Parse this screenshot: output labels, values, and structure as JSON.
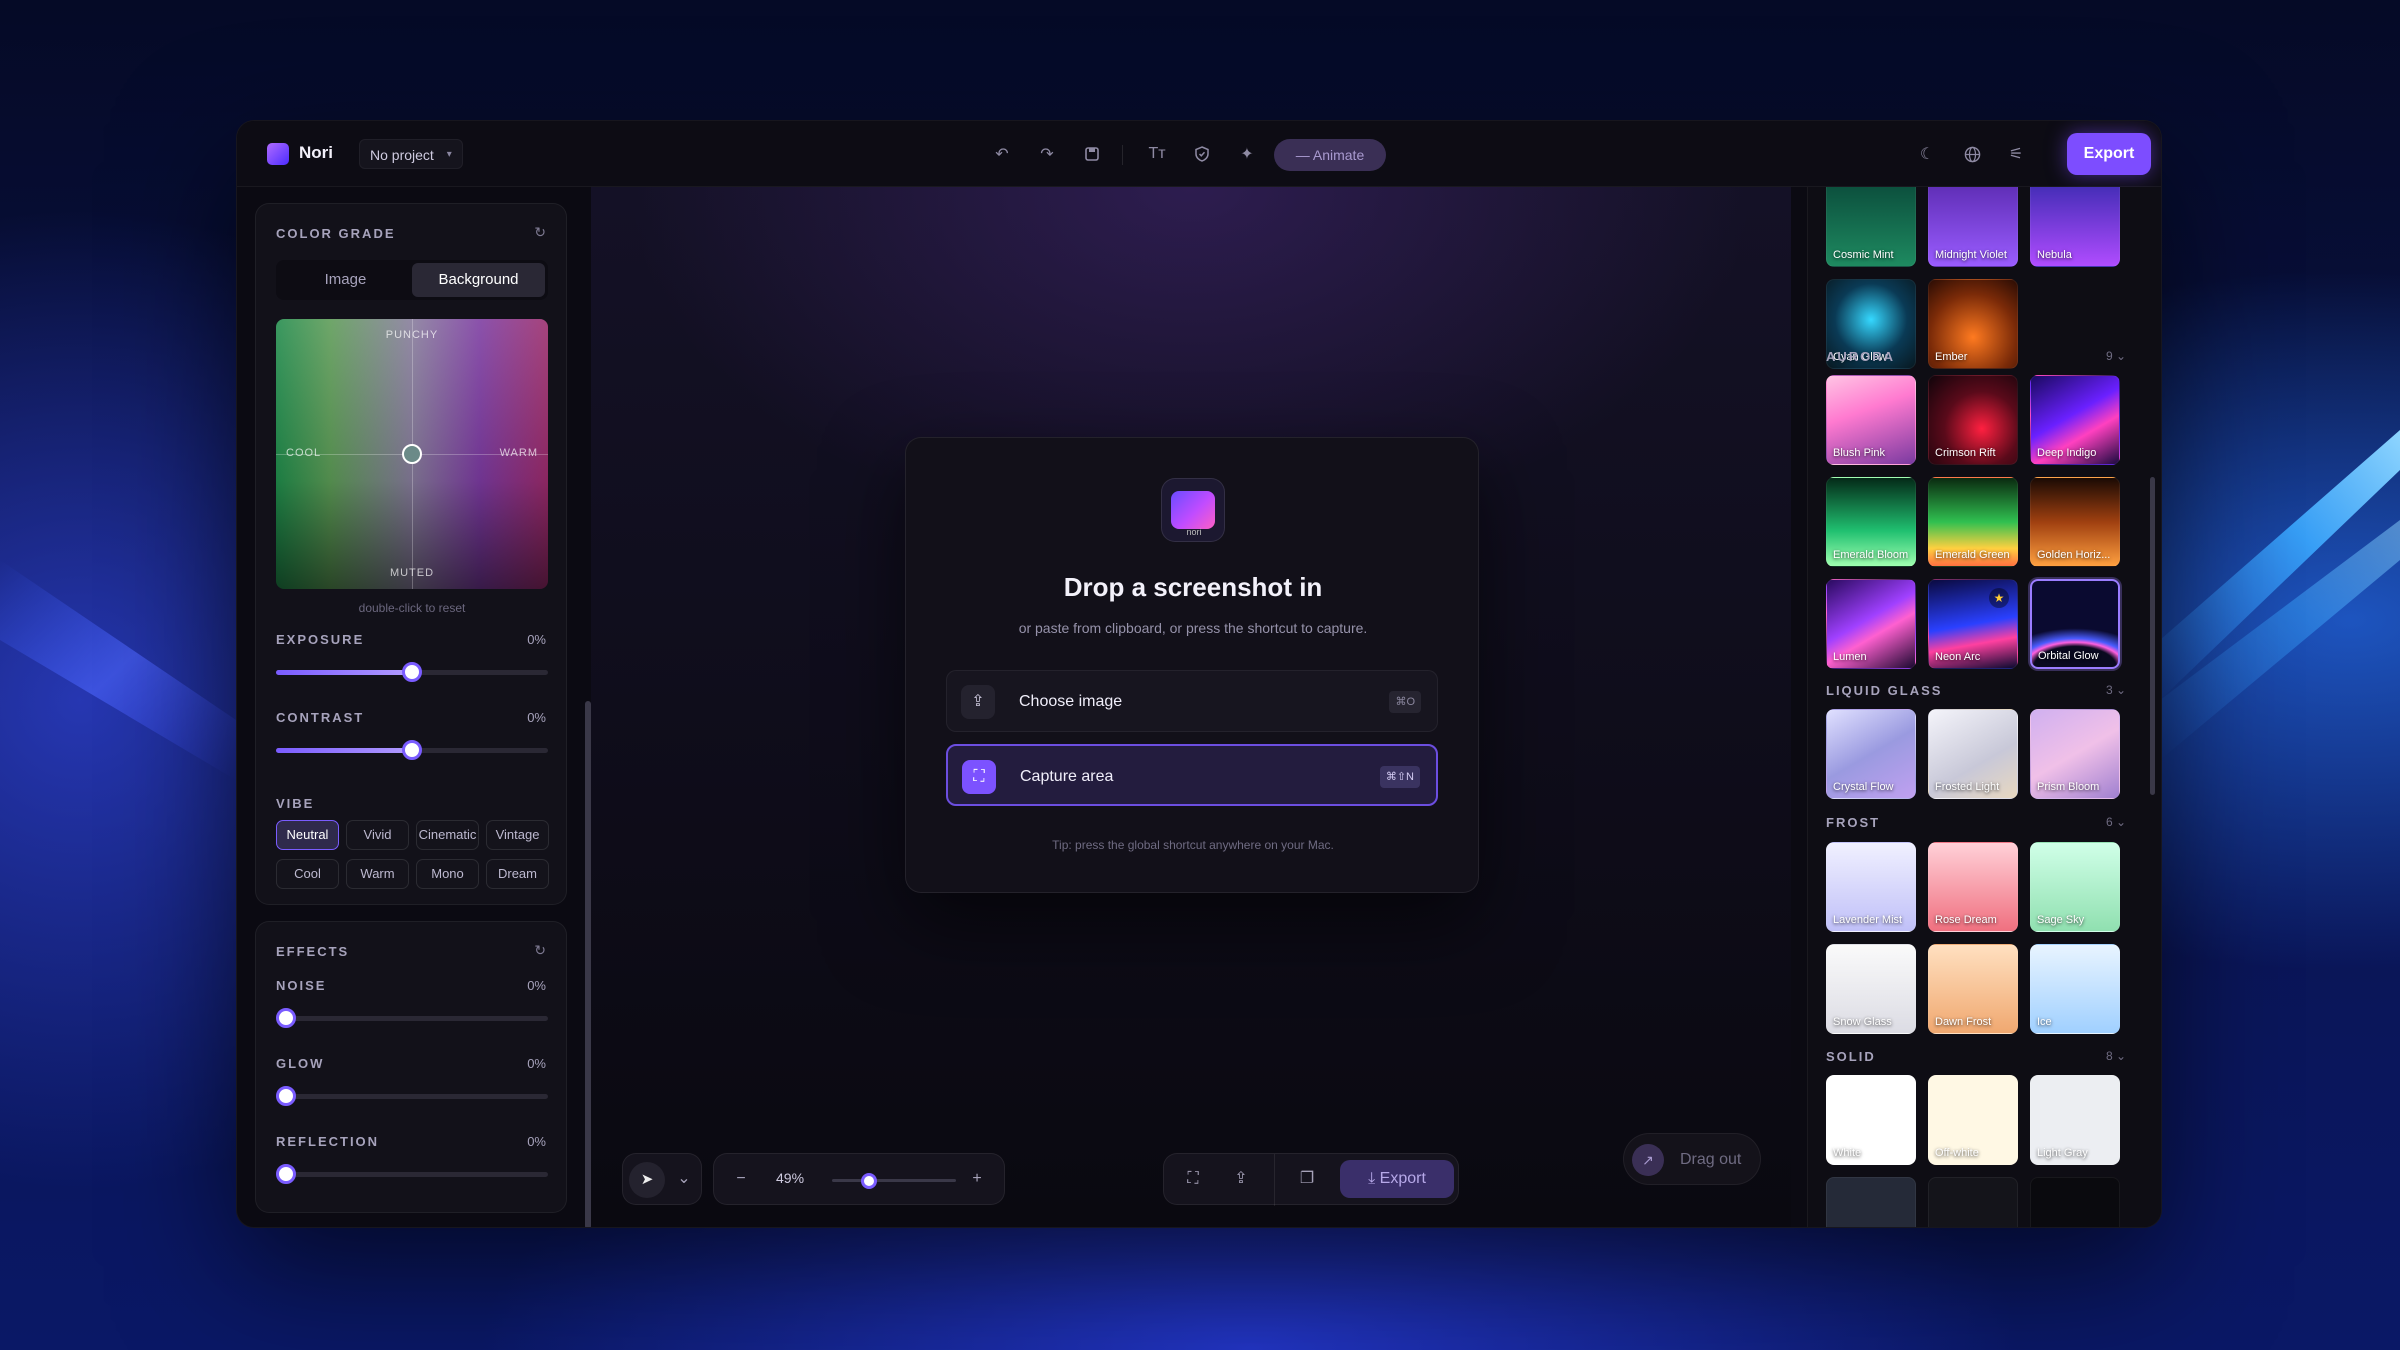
{
  "app": {
    "name": "Nori",
    "project": "No project",
    "animate": "Animate",
    "export": "Export"
  },
  "color_grade": {
    "title": "COLOR GRADE",
    "tabs": [
      "Image",
      "Background"
    ],
    "active_tab": "Background",
    "grid": {
      "top": "PUNCHY",
      "bottom": "MUTED",
      "left": "COOL",
      "right": "WARM"
    },
    "hint": "double-click to reset"
  },
  "sliders": {
    "exposure": {
      "label": "EXPOSURE",
      "value": "0%",
      "level": 0.5
    },
    "contrast": {
      "label": "CONTRAST",
      "value": "0%",
      "level": 0.5
    },
    "noise": {
      "label": "NOISE",
      "value": "0%",
      "level": 0
    },
    "glow": {
      "label": "GLOW",
      "value": "0%",
      "level": 0
    },
    "reflection": {
      "label": "REFLECTION",
      "value": "0%",
      "level": 0
    }
  },
  "vibe": {
    "title": "VIBE",
    "options": [
      "Neutral",
      "Vivid",
      "Cinematic",
      "Vintage",
      "Cool",
      "Warm",
      "Mono",
      "Dream"
    ],
    "selected": "Neutral"
  },
  "effects": {
    "title": "EFFECTS"
  },
  "dialog": {
    "title": "Drop a screenshot in",
    "subtitle": "or paste from clipboard, or press the shortcut to capture.",
    "choose": {
      "label": "Choose image",
      "shortcut": "⌘O"
    },
    "capture": {
      "label": "Capture area",
      "shortcut": "⌘⇧N"
    },
    "tip": "Tip: press the global shortcut anywhere on your Mac."
  },
  "bottom": {
    "zoom": "49%",
    "zoom_level": 0.23,
    "export": "Export",
    "drag_out": "Drag out"
  },
  "presets": {
    "top_row": [
      "Cosmic Mint",
      "Midnight Violet",
      "Nebula"
    ],
    "second_row": [
      "Cyan Glow",
      "Ember"
    ],
    "aurora": {
      "title": "AURORA",
      "count": "9",
      "items": [
        "Blush Pink",
        "Crimson Rift",
        "Deep Indigo",
        "Emerald Bloom",
        "Emerald Green",
        "Golden Horiz...",
        "Lumen",
        "Neon Arc",
        "Orbital Glow"
      ]
    },
    "liquid_glass": {
      "title": "LIQUID GLASS",
      "count": "3",
      "items": [
        "Crystal Flow",
        "Frosted Light",
        "Prism Bloom"
      ]
    },
    "frost": {
      "title": "FROST",
      "count": "6",
      "items": [
        "Lavender Mist",
        "Rose Dream",
        "Sage Sky",
        "Snow Glass",
        "Dawn Frost",
        "Ice"
      ]
    },
    "solid": {
      "title": "SOLID",
      "count": "8",
      "items": [
        "White",
        "Off-white",
        "Light Gray"
      ]
    }
  }
}
